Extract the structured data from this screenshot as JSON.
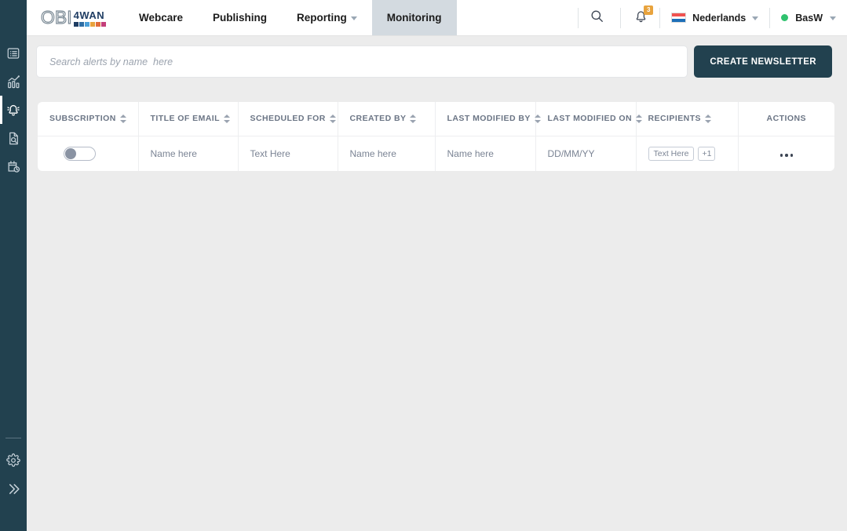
{
  "sidebar": {
    "items": [
      {
        "name": "list-icon",
        "label": "Overview",
        "active": false
      },
      {
        "name": "analytics-icon",
        "label": "Analytics",
        "active": false
      },
      {
        "name": "bell-icon",
        "label": "Alerts",
        "active": true
      },
      {
        "name": "document-search-icon",
        "label": "Reports",
        "active": false
      },
      {
        "name": "calendar-clock-icon",
        "label": "Scheduled",
        "active": false
      }
    ],
    "bottom": [
      {
        "name": "gear-icon",
        "label": "Settings"
      },
      {
        "name": "double-chevron-right-icon",
        "label": "Expand menu"
      }
    ],
    "background": "#22414f",
    "active_indicator": "#ffffff"
  },
  "logo": {
    "primary_text": "OBI",
    "secondary_text": "4WAN",
    "square_colors": [
      "#1f3d63",
      "#2e6da4",
      "#4a9fd8",
      "#e8a33d",
      "#e06c3b",
      "#c43f7a"
    ]
  },
  "nav": {
    "tabs": [
      {
        "label": "Webcare",
        "active": false,
        "has_caret": false
      },
      {
        "label": "Publishing",
        "active": false,
        "has_caret": false
      },
      {
        "label": "Reporting",
        "active": false,
        "has_caret": true
      },
      {
        "label": "Monitoring",
        "active": true,
        "has_caret": false
      }
    ],
    "active_tab_background": "#d3dae0",
    "search_icon": "search-icon",
    "notifications": {
      "icon": "bell-icon",
      "badge": "3",
      "badge_color": "#e8a33d"
    },
    "language": {
      "flag": "flag-netherlands-icon",
      "label": "Nederlands",
      "caret": true
    },
    "user": {
      "status": "online",
      "status_color": "#2fc26e",
      "label": "BasW",
      "caret": true
    }
  },
  "toolbar": {
    "search_placeholder": "Search alerts by name  here",
    "search_value": "",
    "create_button_label": "CREATE NEWSLETTER",
    "create_button_color": "#22414f"
  },
  "table": {
    "columns": [
      {
        "label": "SUBSCRIPTION",
        "sortable": true
      },
      {
        "label": "TITLE OF EMAIL",
        "sortable": true
      },
      {
        "label": "SCHEDULED FOR",
        "sortable": true
      },
      {
        "label": "CREATED BY",
        "sortable": true
      },
      {
        "label": "LAST MODIFIED BY",
        "sortable": true
      },
      {
        "label": "LAST MODIFIED ON",
        "sortable": true
      },
      {
        "label": "RECIPIENTS",
        "sortable": true
      },
      {
        "label": "ACTIONS",
        "sortable": false
      }
    ],
    "rows": [
      {
        "subscription_on": false,
        "title_of_email": "Name here",
        "scheduled_for": "Text Here",
        "created_by": "Name here",
        "last_modified_by": "Name here",
        "last_modified_on": "DD/MM/YY",
        "recipients": [
          "Text Here"
        ],
        "recipients_overflow": "+1",
        "actions_icon": "ellipsis-icon"
      }
    ]
  }
}
